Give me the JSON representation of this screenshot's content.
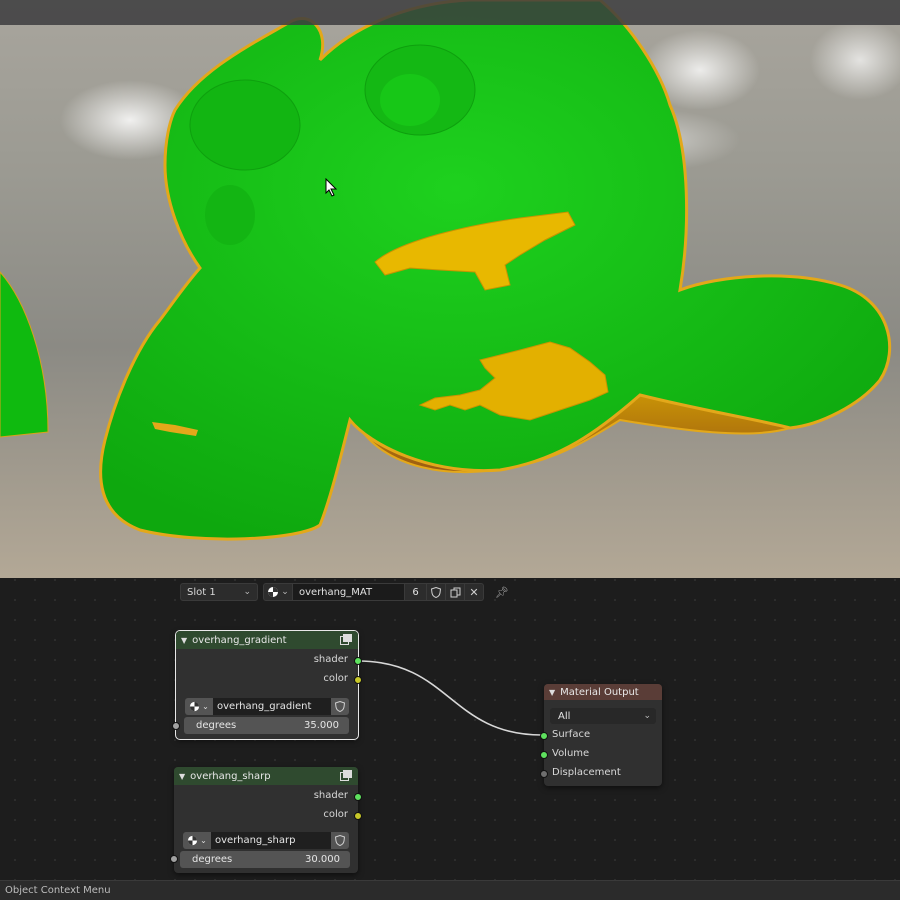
{
  "viewport": {
    "mesh_colors": {
      "surface": "#12c212",
      "overhang": "#e8b800",
      "overhang_dark": "#a86d10",
      "rim": "#e3a81a"
    }
  },
  "node_editor": {
    "header": {
      "slot": "Slot 1",
      "material_name": "overhang_MAT",
      "user_count": "6"
    },
    "nodes": {
      "gradient": {
        "title": "overhang_gradient",
        "outputs": [
          "shader",
          "color"
        ],
        "datablock": "overhang_gradient",
        "input_label": "degrees",
        "input_value": "35.000"
      },
      "sharp": {
        "title": "overhang_sharp",
        "outputs": [
          "shader",
          "color"
        ],
        "datablock": "overhang_sharp",
        "input_label": "degrees",
        "input_value": "30.000"
      },
      "output": {
        "title": "Material Output",
        "target": "All",
        "inputs": [
          "Surface",
          "Volume",
          "Displacement"
        ]
      }
    },
    "colors": {
      "shader_socket": "#5ee05e",
      "color_socket": "#c7c729",
      "value_socket": "#a1a1a1",
      "group_header": "#2f4a2f",
      "output_header": "#5a3d37"
    }
  },
  "statusbar": {
    "text": "Object Context Menu"
  }
}
